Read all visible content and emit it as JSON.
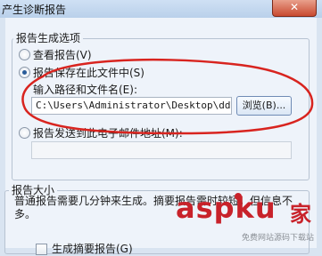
{
  "window": {
    "title": "产生诊断报告",
    "close_glyph": "✕"
  },
  "generation_options": {
    "legend": "报告生成选项",
    "options": [
      {
        "label": "查看报告(V)",
        "checked": false
      },
      {
        "label": "报告保存在此文件中(S)",
        "checked": true
      },
      {
        "label": "报告发送到此电子邮件地址(M):",
        "checked": false
      }
    ],
    "path_label": "输入路径和文件名(E):",
    "path_value": "C:\\Users\\Administrator\\Desktop\\dd.h",
    "browse_label": "浏览(B)...",
    "email_value": ""
  },
  "report_size": {
    "legend": "报告大小",
    "description": "普通报告需要几分钟来生成。摘要报告需时较短，但信息不多。",
    "summary_checkbox_label": "生成摘要报告(G)",
    "summary_checked": false
  },
  "watermark": {
    "brand": "aspku",
    "brand_suffix": "家",
    "tagline": "免费网站源码下载站"
  },
  "colors": {
    "annotation": "#d8241f",
    "window_bg": "#eef3fa",
    "title_bar": "#c4d8ef",
    "close_button": "#c8492f",
    "watermark": "#c8222a"
  }
}
